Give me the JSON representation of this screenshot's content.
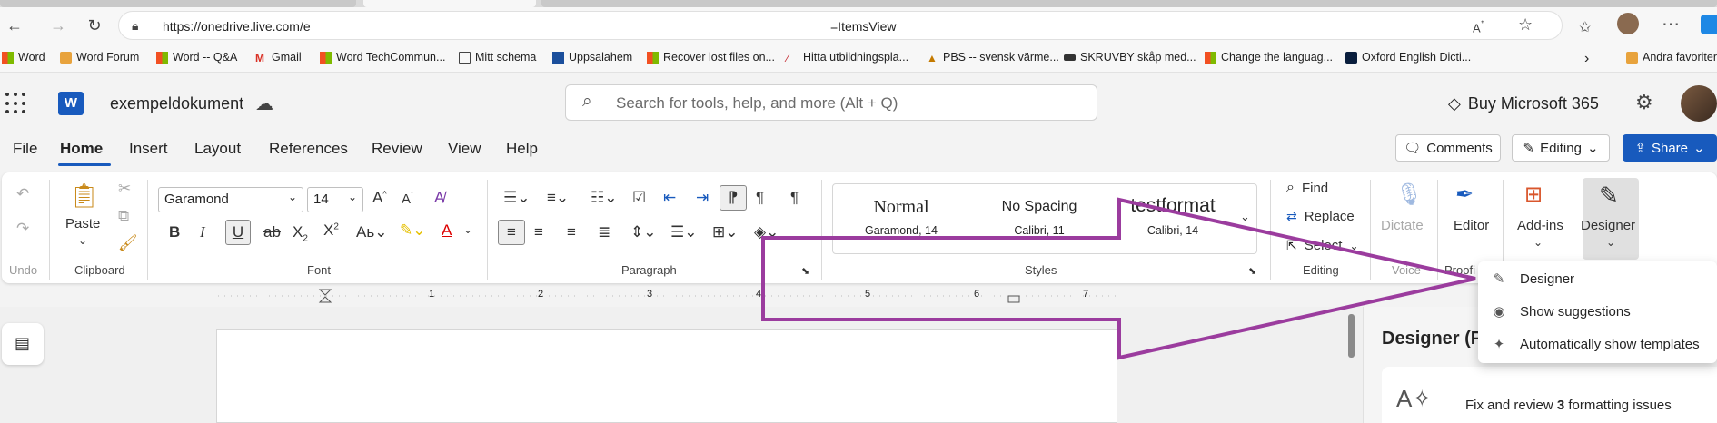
{
  "browser": {
    "url_left": "https://onedrive.live.com/e",
    "url_right": "=ItemsView"
  },
  "bookmarks": [
    {
      "label": "Word"
    },
    {
      "label": "Word Forum"
    },
    {
      "label": "Word -- Q&A"
    },
    {
      "label": "Gmail"
    },
    {
      "label": "Word TechCommun..."
    },
    {
      "label": "Mitt schema"
    },
    {
      "label": "Uppsalahem"
    },
    {
      "label": "Recover lost files on..."
    },
    {
      "label": "Hitta utbildningspla..."
    },
    {
      "label": "PBS -- svensk värme..."
    },
    {
      "label": "SKRUVBY skåp med..."
    },
    {
      "label": "Change the languag..."
    },
    {
      "label": "Oxford English Dicti..."
    },
    {
      "label": "Andra favoriter"
    }
  ],
  "word": {
    "logo": "W",
    "doc_name": "exempeldokument",
    "search_placeholder": "Search for tools, help, and more (Alt + Q)",
    "buy": "Buy Microsoft 365"
  },
  "menu": {
    "tabs": [
      "File",
      "Home",
      "Insert",
      "Layout",
      "References",
      "Review",
      "View",
      "Help"
    ],
    "comments": "Comments",
    "editing": "Editing",
    "share": "Share"
  },
  "ribbon": {
    "undo_label": "Undo",
    "clipboard_label": "Clipboard",
    "paste": "Paste",
    "font_label": "Font",
    "font_name": "Garamond",
    "font_size": "14",
    "paragraph_label": "Paragraph",
    "styles_label": "Styles",
    "styles": [
      {
        "name": "Normal",
        "desc": "Garamond, 14"
      },
      {
        "name": "No Spacing",
        "desc": "Calibri, 11"
      },
      {
        "name": "testformat",
        "desc": "Calibri, 14"
      }
    ],
    "find": "Find",
    "replace": "Replace",
    "select": "Select",
    "editing_label": "Editing",
    "dictate": "Dictate",
    "voice_label": "Voice",
    "editor": "Editor",
    "proofing_label": "Proofi",
    "addins": "Add-ins",
    "designer": "Designer"
  },
  "ruler": {
    "numbers": [
      "1",
      "2",
      "3",
      "4",
      "5",
      "6",
      "7"
    ]
  },
  "designer_pane": {
    "title": "Designer (P",
    "card_text_pre": "Fix and review ",
    "card_count": "3",
    "card_text_post": " formatting issues"
  },
  "dropdown": {
    "items": [
      {
        "label": "Designer",
        "icon": "wand-icon"
      },
      {
        "label": "Show suggestions",
        "icon": "eye-icon"
      },
      {
        "label": "Automatically show templates",
        "icon": "auto-template-icon"
      }
    ]
  },
  "colors": {
    "accent": "#185abd",
    "arrow": "#9b3c9e"
  }
}
